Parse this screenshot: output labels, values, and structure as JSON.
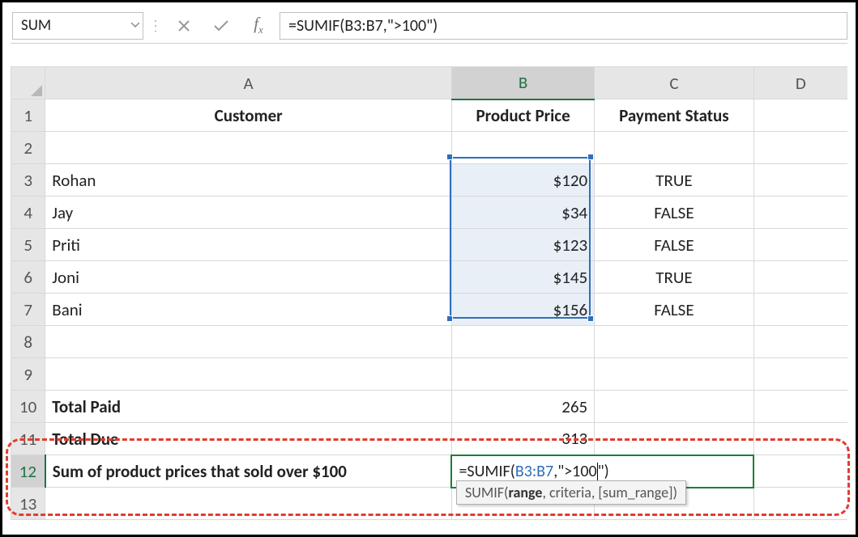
{
  "nameBox": "SUM",
  "formulaBar": "=SUMIF(B3:B7,\">100\")",
  "colHeaders": [
    "A",
    "B",
    "C",
    "D"
  ],
  "rowCount": 13,
  "headerRow": {
    "A": "Customer",
    "B": "Product Price",
    "C": "Payment Status"
  },
  "rows": [
    {
      "A": "Rohan",
      "B": "$120",
      "C": "TRUE"
    },
    {
      "A": "Jay",
      "B": "$34",
      "C": "FALSE"
    },
    {
      "A": "Priti",
      "B": "$123",
      "C": "FALSE"
    },
    {
      "A": "Joni",
      "B": "$145",
      "C": "TRUE"
    },
    {
      "A": "Bani",
      "B": "$156",
      "C": "FALSE"
    }
  ],
  "totalPaid": {
    "label": "Total Paid",
    "value": "265"
  },
  "totalDue": {
    "label": "Total Due",
    "value": "313"
  },
  "sumRow": {
    "label": "Sum of product prices that sold over $100",
    "prefix": "=SUMIF(",
    "range": "B3:B7",
    "mid": ",\"",
    "criteria": ">100",
    "suffix": "\")"
  },
  "tooltip": {
    "fn": "SUMIF",
    "bold": "range",
    "rest": ", criteria, [sum_range])"
  }
}
